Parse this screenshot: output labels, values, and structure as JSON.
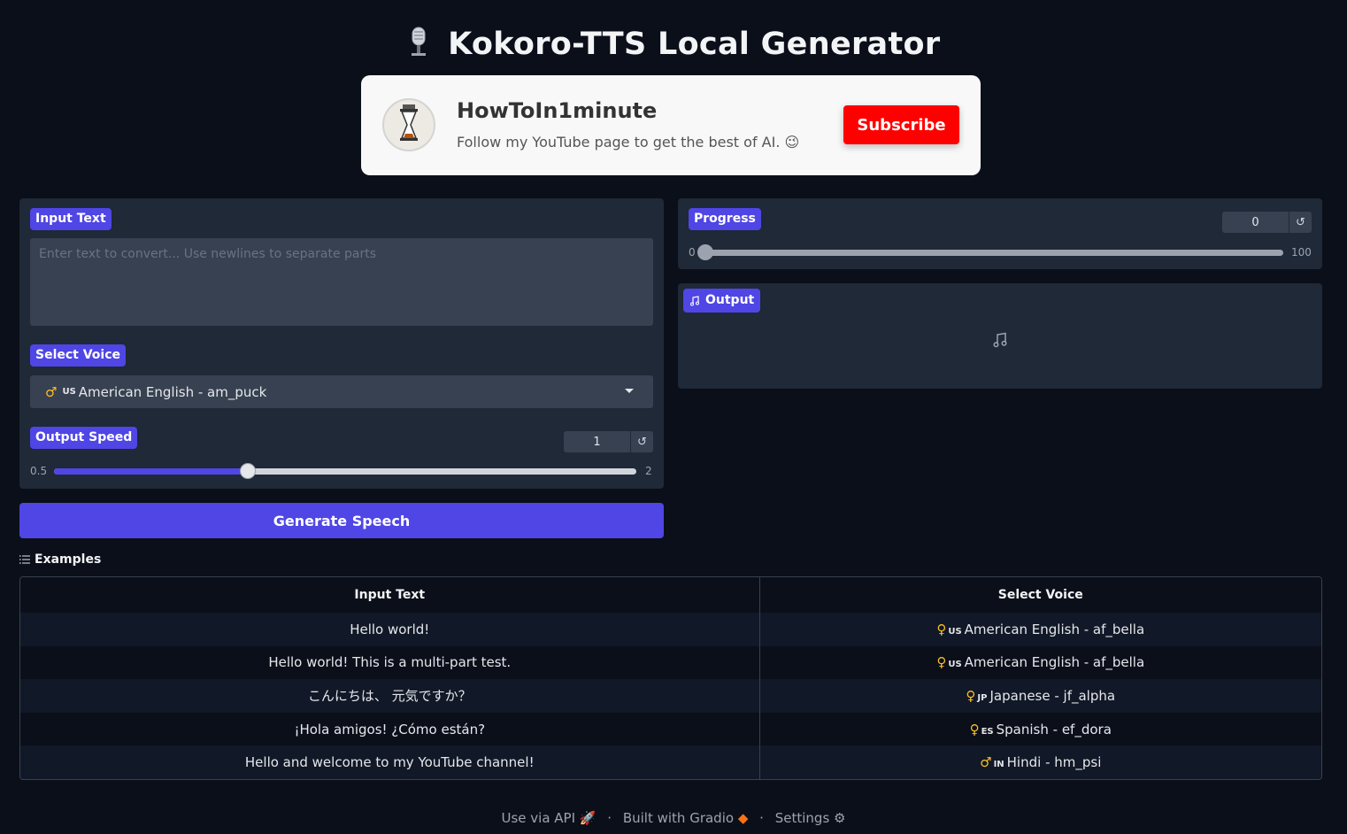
{
  "app": {
    "title": "Kokoro-TTS Local Generator"
  },
  "promo": {
    "channel_name": "HowToIn1minute",
    "description": "Follow my YouTube page to get the best of AI. 😉",
    "subscribe_label": "Subscribe",
    "subscribe_color": "#ff0000"
  },
  "input_panel": {
    "input_label": "Input Text",
    "input_placeholder": "Enter text to convert... Use newlines to separate parts",
    "input_value": "",
    "voice_label": "Select Voice",
    "voice_gender_icon": "male-symbol-icon",
    "voice_flag": "US",
    "voice_value": "American English - am_puck",
    "speed_label": "Output Speed",
    "speed_value": "1",
    "speed_min": "0.5",
    "speed_max": "2",
    "speed_fraction": 0.333
  },
  "generate_label": "Generate Speech",
  "progress_panel": {
    "label": "Progress",
    "value": "0",
    "min": "0",
    "max": "100",
    "fraction": 0
  },
  "output_panel": {
    "label": "Output"
  },
  "examples": {
    "label": "Examples",
    "headers": [
      "Input Text",
      "Select Voice"
    ],
    "rows": [
      {
        "text": "Hello world!",
        "gender": "♀",
        "flag": "US",
        "voice": "American English - af_bella"
      },
      {
        "text": "Hello world! This is a multi-part test.",
        "gender": "♀",
        "flag": "US",
        "voice": "American English - af_bella"
      },
      {
        "text": "こんにちは、 元気ですか？",
        "gender": "♀",
        "flag": "JP",
        "voice": "Japanese - jf_alpha"
      },
      {
        "text": "¡Hola amigos! ¿Cómo están?",
        "gender": "♀",
        "flag": "ES",
        "voice": "Spanish - ef_dora"
      },
      {
        "text": "Hello and welcome to my YouTube channel!",
        "gender": "♂",
        "flag": "IN",
        "voice": "Hindi - hm_psi"
      }
    ]
  },
  "footer": {
    "api": "Use via API",
    "gradio": "Built with Gradio",
    "settings": "Settings"
  },
  "colors": {
    "accent": "#4f46e5",
    "background": "#0b0f19",
    "panel": "#1f2937"
  }
}
